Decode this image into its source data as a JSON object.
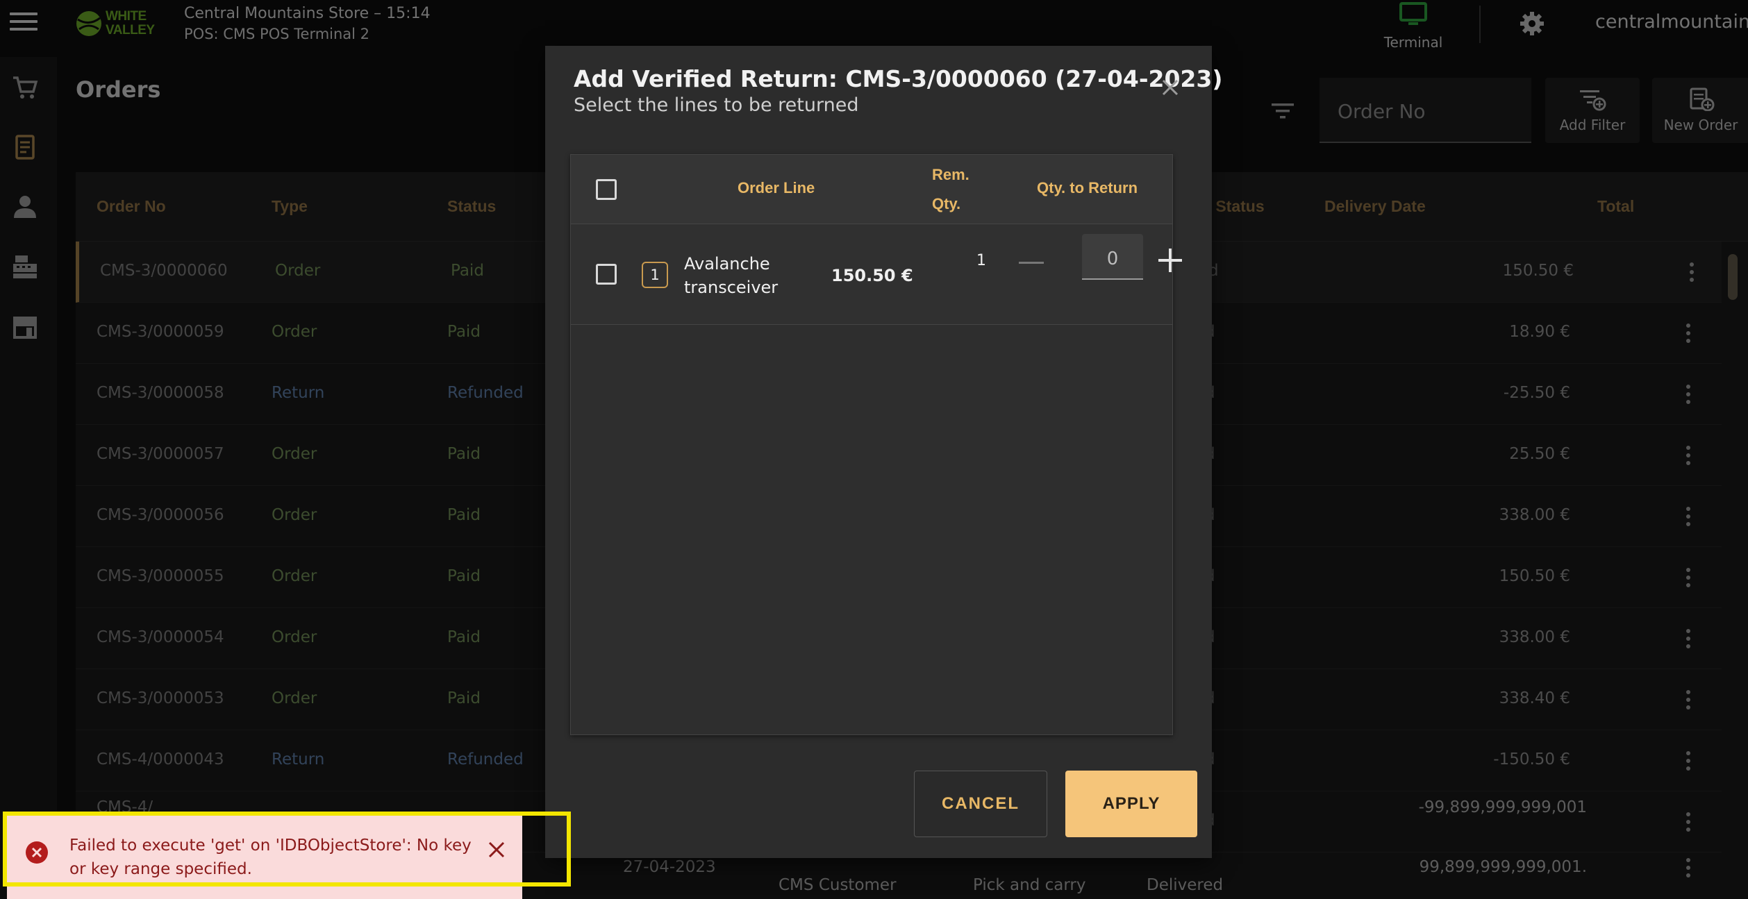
{
  "header": {
    "logo_line1": "WHITE",
    "logo_line2": "VALLEY",
    "store_time": "Central Mountains Store – 15:14",
    "terminal_name": "POS: CMS POS Terminal 2",
    "terminal_label": "Terminal",
    "username": "centralmountains",
    "colors": {
      "terminal_icon": "#2e9e3c",
      "logo": "#6aa629"
    }
  },
  "sidebar": {
    "items": [
      {
        "icon": "cart-icon"
      },
      {
        "icon": "receipt-icon"
      },
      {
        "icon": "person-icon"
      },
      {
        "icon": "cash-register-icon"
      },
      {
        "icon": "store-icon"
      }
    ]
  },
  "page": {
    "title": "Orders",
    "search_placeholder": "Order No",
    "add_filter_label": "Add Filter",
    "new_order_label": "New Order"
  },
  "table": {
    "columns": [
      "Order No",
      "Type",
      "Status",
      "r Status",
      "Delivery Date",
      "Total"
    ],
    "rows": [
      {
        "order_no": "CMS-3/0000060",
        "type": "Order",
        "status": "Paid",
        "delivery": "d",
        "total": "150.50 €"
      },
      {
        "order_no": "CMS-3/0000059",
        "type": "Order",
        "status": "Paid",
        "delivery": "d",
        "total": "18.90 €"
      },
      {
        "order_no": "CMS-3/0000058",
        "type": "Return",
        "status": "Refunded",
        "delivery": "d",
        "total": "-25.50 €"
      },
      {
        "order_no": "CMS-3/0000057",
        "type": "Order",
        "status": "Paid",
        "delivery": "d",
        "total": "25.50 €"
      },
      {
        "order_no": "CMS-3/0000056",
        "type": "Order",
        "status": "Paid",
        "delivery": "d",
        "total": "338.00 €"
      },
      {
        "order_no": "CMS-3/0000055",
        "type": "Order",
        "status": "Paid",
        "delivery": "d",
        "total": "150.50 €"
      },
      {
        "order_no": "CMS-3/0000054",
        "type": "Order",
        "status": "Paid",
        "delivery": "d",
        "total": "338.00 €"
      },
      {
        "order_no": "CMS-3/0000053",
        "type": "Order",
        "status": "Paid",
        "delivery": "d",
        "total": "338.40 €"
      },
      {
        "order_no": "CMS-4/0000043",
        "type": "Return",
        "status": "Refunded",
        "delivery": "d",
        "total": "-150.50 €"
      },
      {
        "order_no": "CMS-4/",
        "type": "",
        "status": "",
        "delivery": "d",
        "total": "-99,899,999,999,001"
      }
    ],
    "partial_row": {
      "date": "27-04-2023",
      "customer": "CMS Customer",
      "delivery_mode": "Pick and carry",
      "delivery_status": "Delivered",
      "total": "99,899,999,999,001."
    }
  },
  "dialog": {
    "title": "Add Verified Return: CMS-3/0000060 (27-04-2023)",
    "subtitle": "Select the lines to be returned",
    "col_order_line": "Order Line",
    "col_rem_qty_1": "Rem.",
    "col_rem_qty_2": "Qty.",
    "col_qty_return": "Qty. to Return",
    "line": {
      "number": "1",
      "name": "Avalanche transceiver",
      "price": "150.50 €",
      "rem_qty": "1",
      "qty_to_return": "0"
    },
    "cancel_label": "CANCEL",
    "apply_label": "APPLY",
    "colors": {
      "accent": "#e8b866",
      "apply_bg": "#f5c57a"
    }
  },
  "toast": {
    "message": "Failed to execute 'get' on 'IDBObjectStore': No key or key range specified.",
    "colors": {
      "bg": "#fadbdb",
      "text": "#8b1a1a",
      "icon": "#b31d1d",
      "highlight": "#f3e600"
    }
  }
}
